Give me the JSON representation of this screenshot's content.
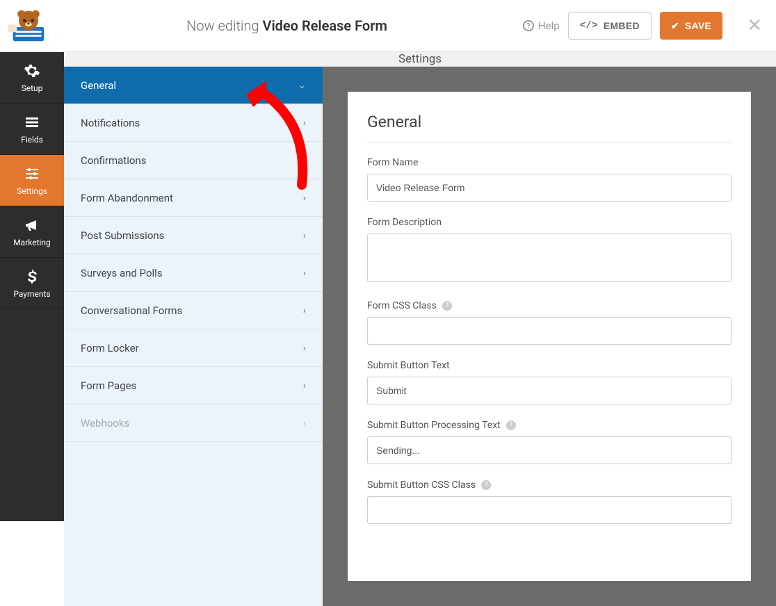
{
  "header": {
    "editing_prefix": "Now editing",
    "form_title": "Video Release Form",
    "help_label": "Help",
    "embed_label": "EMBED",
    "save_label": "SAVE"
  },
  "leftnav": [
    {
      "id": "setup",
      "label": "Setup",
      "icon": "gear"
    },
    {
      "id": "fields",
      "label": "Fields",
      "icon": "list"
    },
    {
      "id": "settings",
      "label": "Settings",
      "icon": "sliders",
      "active": true
    },
    {
      "id": "marketing",
      "label": "Marketing",
      "icon": "megaphone"
    },
    {
      "id": "payments",
      "label": "Payments",
      "icon": "dollar"
    }
  ],
  "sub_header": "Settings",
  "settings_menu": [
    {
      "label": "General",
      "active": true
    },
    {
      "label": "Notifications"
    },
    {
      "label": "Confirmations"
    },
    {
      "label": "Form Abandonment"
    },
    {
      "label": "Post Submissions"
    },
    {
      "label": "Surveys and Polls"
    },
    {
      "label": "Conversational Forms"
    },
    {
      "label": "Form Locker"
    },
    {
      "label": "Form Pages"
    },
    {
      "label": "Webhooks",
      "muted": true
    }
  ],
  "panel": {
    "heading": "General",
    "fields": {
      "form_name": {
        "label": "Form Name",
        "value": "Video Release Form"
      },
      "form_description": {
        "label": "Form Description",
        "value": ""
      },
      "form_css_class": {
        "label": "Form CSS Class",
        "value": "",
        "help": true
      },
      "submit_button_text": {
        "label": "Submit Button Text",
        "value": "Submit"
      },
      "submit_button_processing_text": {
        "label": "Submit Button Processing Text",
        "value": "Sending...",
        "help": true
      },
      "submit_button_css_class": {
        "label": "Submit Button CSS Class",
        "value": "",
        "help": true
      }
    }
  }
}
